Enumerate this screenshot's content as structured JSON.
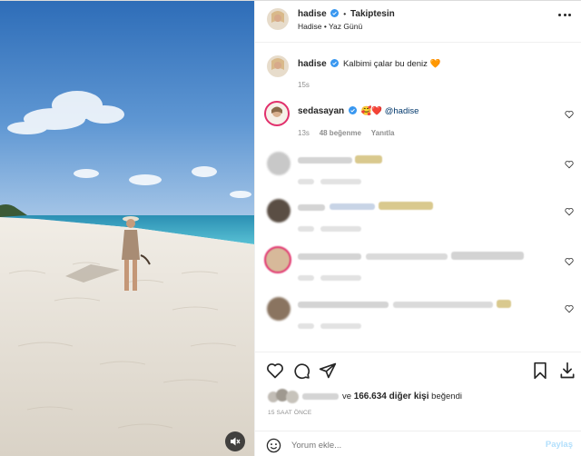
{
  "header": {
    "username": "hadise",
    "separator": "•",
    "follow_status": "Takiptesin",
    "subtitle": "Hadise • Yaz Günü"
  },
  "caption": {
    "username": "hadise",
    "text": "Kalbimi çalar bu deniz",
    "emoji": "🧡",
    "time": "15s"
  },
  "comments": [
    {
      "username": "sedasayan",
      "emojis": "🥰❤️",
      "mention": "@hadise",
      "time": "13s",
      "likes": "48 beğenme",
      "reply": "Yanıtla"
    }
  ],
  "likes": {
    "prefix": "ve",
    "count_text": "166.634 diğer kişi",
    "suffix": "beğendi"
  },
  "post_time": "15 SAAT ÖNCE",
  "comment_input": {
    "placeholder": "Yorum ekle...",
    "post_label": "Paylaş"
  },
  "colors": {
    "verified": "#3897f0",
    "link": "#00376b",
    "post_button": "#b2dffc",
    "sea": "#3ba3c4",
    "sand": "#e9e4dc"
  },
  "icons": {
    "like": "heart-outline-icon",
    "comment": "comment-icon",
    "share": "paper-plane-icon",
    "save": "bookmark-icon",
    "download": "download-icon",
    "emoji": "smiley-icon",
    "audio": "muted-speaker-icon"
  }
}
